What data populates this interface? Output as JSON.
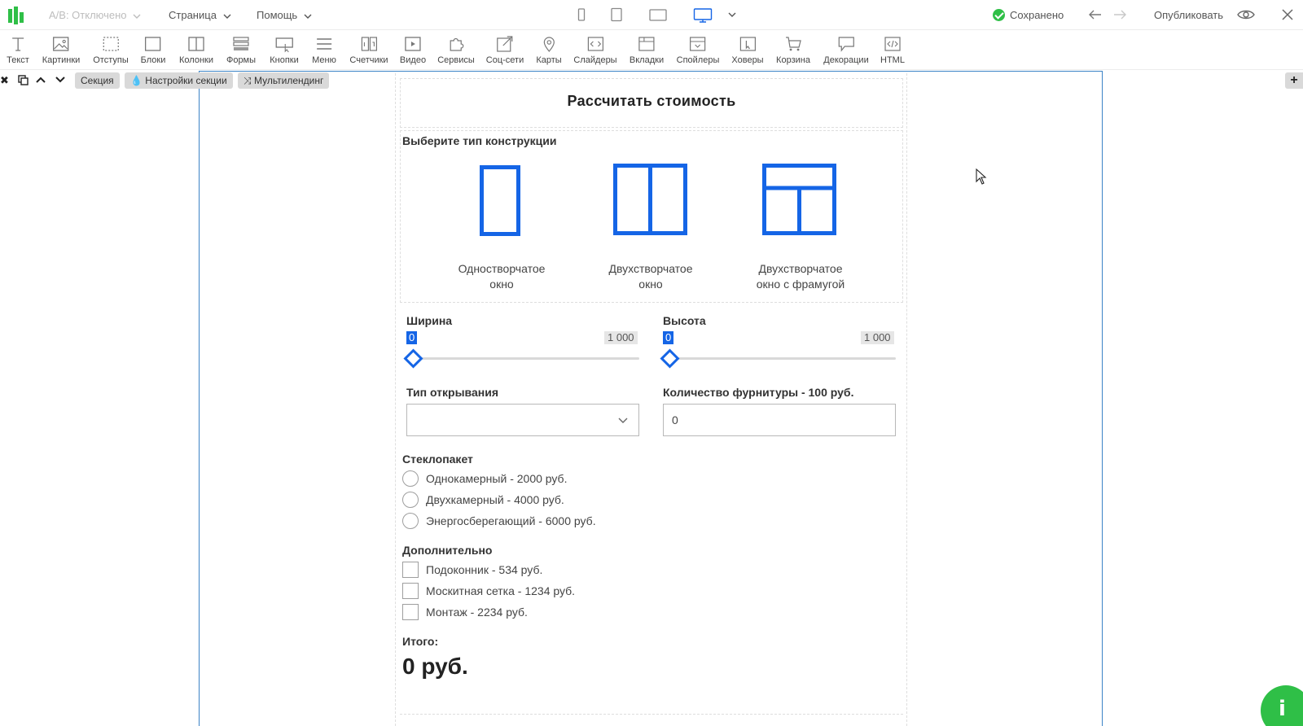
{
  "topbar": {
    "ab_test": "A/B: Отключено",
    "page_menu": "Страница",
    "help_menu": "Помощь",
    "saved_status": "Сохранено",
    "publish": "Опубликовать"
  },
  "toolbar": {
    "tools": [
      {
        "label": "Текст",
        "icon": "text-icon"
      },
      {
        "label": "Картинки",
        "icon": "image-icon"
      },
      {
        "label": "Отступы",
        "icon": "spacing-icon"
      },
      {
        "label": "Блоки",
        "icon": "block-icon"
      },
      {
        "label": "Колонки",
        "icon": "columns-icon"
      },
      {
        "label": "Формы",
        "icon": "form-icon"
      },
      {
        "label": "Кнопки",
        "icon": "button-icon"
      },
      {
        "label": "Меню",
        "icon": "menu-icon"
      },
      {
        "label": "Счетчики",
        "icon": "counter-icon"
      },
      {
        "label": "Видео",
        "icon": "video-icon"
      },
      {
        "label": "Сервисы",
        "icon": "puzzle-icon"
      },
      {
        "label": "Соц-сети",
        "icon": "share-icon"
      },
      {
        "label": "Карты",
        "icon": "map-pin-icon"
      },
      {
        "label": "Слайдеры",
        "icon": "slider-icon"
      },
      {
        "label": "Вкладки",
        "icon": "tabs-icon"
      },
      {
        "label": "Спойлеры",
        "icon": "spoiler-icon"
      },
      {
        "label": "Ховеры",
        "icon": "hover-icon"
      },
      {
        "label": "Корзина",
        "icon": "cart-icon"
      },
      {
        "label": "Декорации",
        "icon": "decoration-icon"
      },
      {
        "label": "HTML",
        "icon": "code-icon"
      }
    ]
  },
  "section_bar": {
    "section": "Секция",
    "section_settings": "Настройки секции",
    "multilanding": "Мультилендинг"
  },
  "form": {
    "title": "Рассчитать стоимость",
    "construction_label": "Выберите тип конструкции",
    "window_types": [
      {
        "line1": "Одностворчатое",
        "line2": "окно"
      },
      {
        "line1": "Двухстворчатое",
        "line2": "окно"
      },
      {
        "line1": "Двухстворчатое",
        "line2": "окно с фрамугой"
      }
    ],
    "width": {
      "label": "Ширина",
      "min": "0",
      "max": "1 000",
      "value": 0
    },
    "height": {
      "label": "Высота",
      "min": "0",
      "max": "1 000",
      "value": 0
    },
    "opening_type_label": "Тип открывания",
    "opening_type_value": "",
    "fittings_label": "Количество фурнитуры - 100 руб.",
    "fittings_value": "0",
    "glass_label": "Стеклопакет",
    "glass_options": [
      "Однокамерный - 2000 руб.",
      "Двухкамерный - 4000 руб.",
      "Энергосберегающий - 6000 руб."
    ],
    "extra_label": "Дополнительно",
    "extra_options": [
      "Подоконник - 534 руб.",
      "Москитная сетка - 1234 руб.",
      "Монтаж - 2234 руб."
    ],
    "total_label": "Итого:",
    "total_value": "0 руб."
  },
  "colors": {
    "accent_blue": "#1565e6",
    "canvas_border": "#3b83c6",
    "green": "#2fbf47"
  }
}
